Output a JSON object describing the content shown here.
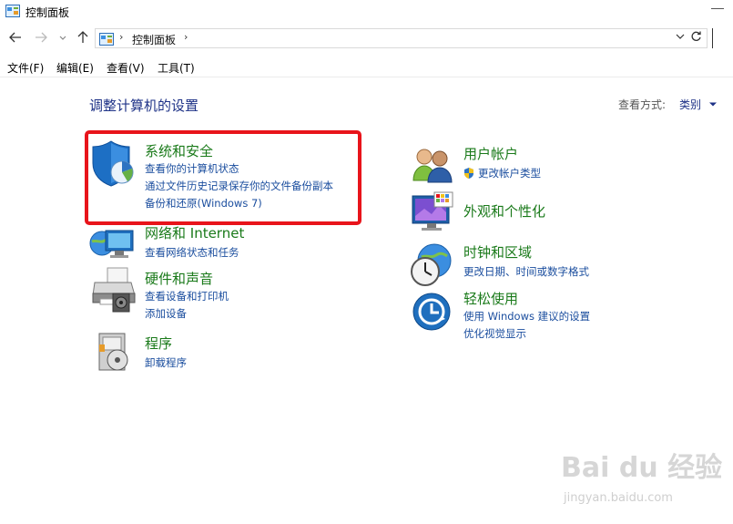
{
  "window": {
    "title": "控制面板"
  },
  "nav": {
    "back_icon": "arrow-left-icon",
    "forward_icon": "arrow-right-icon",
    "recent_icon": "chevron-down-icon",
    "up_icon": "arrow-up-icon",
    "refresh_icon": "refresh-icon"
  },
  "address": {
    "path": "控制面板"
  },
  "menu": [
    "文件(F)",
    "编辑(E)",
    "查看(V)",
    "工具(T)"
  ],
  "header": {
    "title": "调整计算机的设置",
    "view_by_label": "查看方式:",
    "view_by_value": "类别"
  },
  "categories": {
    "system_security": {
      "title": "系统和安全",
      "links": [
        "查看你的计算机状态",
        "通过文件历史记录保存你的文件备份副本",
        "备份和还原(Windows 7)"
      ]
    },
    "network": {
      "title": "网络和 Internet",
      "links": [
        "查看网络状态和任务"
      ]
    },
    "hardware": {
      "title": "硬件和声音",
      "links": [
        "查看设备和打印机",
        "添加设备"
      ]
    },
    "programs": {
      "title": "程序",
      "links": [
        "卸载程序"
      ]
    },
    "user_accounts": {
      "title": "用户帐户",
      "links": [
        "更改帐户类型"
      ]
    },
    "appearance": {
      "title": "外观和个性化",
      "links": []
    },
    "clock_region": {
      "title": "时钟和区域",
      "links": [
        "更改日期、时间或数字格式"
      ]
    },
    "ease_access": {
      "title": "轻松使用",
      "links": [
        "使用 Windows 建议的设置",
        "优化视觉显示"
      ]
    }
  },
  "watermark": {
    "text": "Bai du 经验",
    "sub": "jingyan.baidu.com"
  },
  "colors": {
    "highlight": "#e8141b",
    "link": "#1a4d9e",
    "category_title": "#1a7a1a",
    "page_title": "#1e3287"
  }
}
